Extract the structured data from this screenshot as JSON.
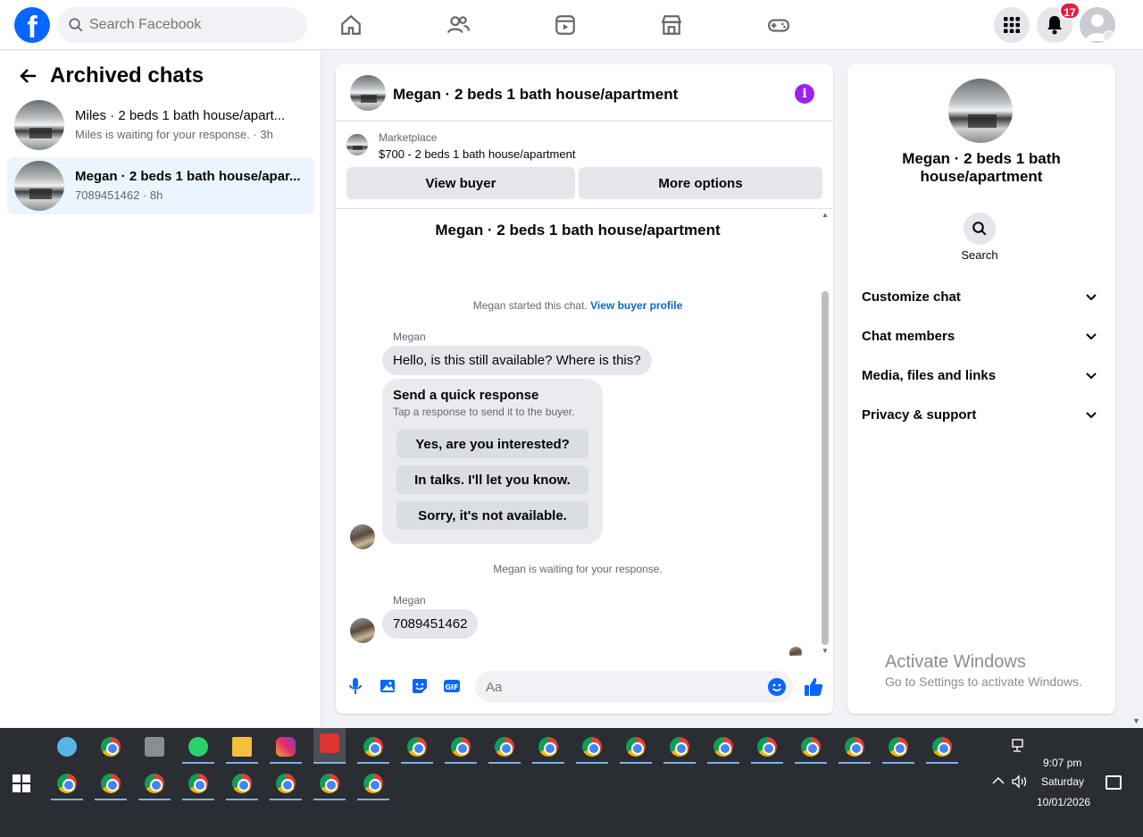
{
  "nav": {
    "logo": "f",
    "search_placeholder": "Search Facebook",
    "notification_count": "17"
  },
  "sidebar": {
    "title": "Archived chats",
    "chats": [
      {
        "name": "Miles · 2 beds 1 bath house/apart...",
        "sub": "Miles is waiting for your response. · 3h"
      },
      {
        "name": "Megan · 2 beds 1 bath house/apar...",
        "sub": "7089451462 · 8h"
      }
    ]
  },
  "chat": {
    "title": "Megan · 2 beds 1 bath house/apartment",
    "marketplace_label": "Marketplace",
    "listing": "$700 - 2 beds 1 bath house/apartment",
    "view_buyer": "View buyer",
    "more_options": "More options",
    "conv_title": "Megan · 2 beds 1 bath house/apartment",
    "started_text": "Megan started this chat.",
    "view_profile": "View buyer profile",
    "sender": "Megan",
    "msg1": "Hello, is this still available? Where is this?",
    "quick_title": "Send a quick response",
    "quick_sub": "Tap a response to send it to the buyer.",
    "quick_replies": [
      "Yes, are you interested?",
      "In talks. I'll let you know.",
      "Sorry, it's not available."
    ],
    "waiting": "Megan is waiting for your response.",
    "msg2": "7089451462",
    "composer_placeholder": "Aa"
  },
  "right": {
    "name": "Megan · 2 beds 1 bath house/apartment",
    "search": "Search",
    "rows": [
      "Customize chat",
      "Chat members",
      "Media, files and links",
      "Privacy & support"
    ],
    "activate_title": "Activate Windows",
    "activate_sub": "Go to Settings to activate Windows."
  },
  "taskbar": {
    "time": "9:07 pm",
    "day": "Saturday",
    "date": "10/01/2026"
  },
  "colors": {
    "brand": "#0866ff",
    "info": "#a020f0",
    "badge": "#e41e3f"
  }
}
